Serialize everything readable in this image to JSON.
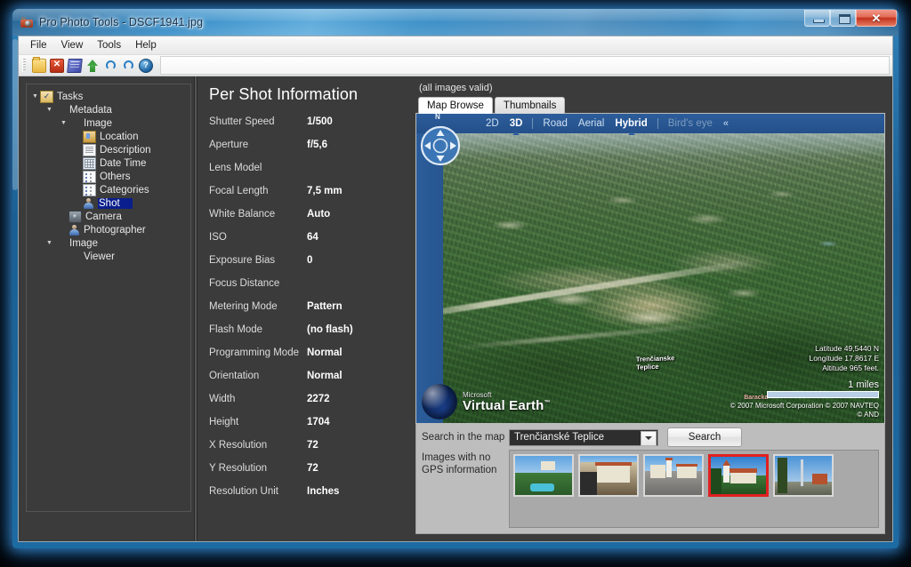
{
  "window": {
    "title": "Pro Photo Tools - DSCF1941.jpg",
    "app_icon": "camera-icon",
    "minimize_label": "–",
    "maximize_label": "□",
    "close_label": "✕"
  },
  "menubar": {
    "items": [
      {
        "label": "File"
      },
      {
        "label": "View"
      },
      {
        "label": "Tools"
      },
      {
        "label": "Help"
      }
    ]
  },
  "toolbar": {
    "buttons": [
      {
        "name": "open-folder-button",
        "icon": "folder-icon"
      },
      {
        "name": "remove-button",
        "icon": "red-x-icon"
      },
      {
        "name": "edit-metadata-button",
        "icon": "note-icon"
      },
      {
        "name": "upload-button",
        "icon": "green-up-arrow-icon"
      },
      {
        "name": "undo-button",
        "icon": "undo-arrow-icon"
      },
      {
        "name": "redo-button",
        "icon": "redo-arrow-icon"
      },
      {
        "name": "help-button",
        "icon": "help-icon"
      }
    ]
  },
  "tree": {
    "nodes": [
      {
        "label": "Tasks",
        "indent": 0,
        "expander": "▼",
        "icon": "tasks-checkbox-icon",
        "selected": false
      },
      {
        "label": "Metadata",
        "indent": 1,
        "expander": "▼",
        "icon": "none",
        "selected": false
      },
      {
        "label": "Image",
        "indent": 2,
        "expander": "▼",
        "icon": "none",
        "selected": false
      },
      {
        "label": "Location",
        "indent": 3,
        "expander": "",
        "icon": "location-icon",
        "selected": false
      },
      {
        "label": "Description",
        "indent": 3,
        "expander": "",
        "icon": "document-icon",
        "selected": false
      },
      {
        "label": "Date Time",
        "indent": 3,
        "expander": "",
        "icon": "calendar-grid-icon",
        "selected": false
      },
      {
        "label": "Others",
        "indent": 3,
        "expander": "",
        "icon": "list-icon",
        "selected": false
      },
      {
        "label": "Categories",
        "indent": 3,
        "expander": "",
        "icon": "list-icon",
        "selected": false
      },
      {
        "label": "Shot",
        "indent": 3,
        "expander": "",
        "icon": "person-icon",
        "selected": true
      },
      {
        "label": "Camera",
        "indent": 2,
        "expander": "",
        "icon": "camera-icon",
        "selected": false
      },
      {
        "label": "Photographer",
        "indent": 2,
        "expander": "",
        "icon": "person-icon",
        "selected": false
      },
      {
        "label": "Image",
        "indent": 1,
        "expander": "▼",
        "icon": "none",
        "selected": false
      },
      {
        "label": "Viewer",
        "indent": 2,
        "expander": "",
        "icon": "none",
        "selected": false
      }
    ]
  },
  "metadata": {
    "title": "Per Shot Information",
    "rows": [
      {
        "label": "Shutter Speed",
        "value": "1/500"
      },
      {
        "label": "Aperture",
        "value": "f/5,6"
      },
      {
        "label": "Lens Model",
        "value": ""
      },
      {
        "label": "Focal Length",
        "value": "7,5 mm"
      },
      {
        "label": "White Balance",
        "value": "Auto"
      },
      {
        "label": "ISO",
        "value": "64"
      },
      {
        "label": "Exposure Bias",
        "value": "0"
      },
      {
        "label": "Focus Distance",
        "value": ""
      },
      {
        "label": "Metering Mode",
        "value": "Pattern"
      },
      {
        "label": "Flash Mode",
        "value": "(no flash)"
      },
      {
        "label": "Programming Mode",
        "value": "Normal"
      },
      {
        "label": "Orientation",
        "value": "Normal"
      },
      {
        "label": "Width",
        "value": "2272"
      },
      {
        "label": "Height",
        "value": "1704"
      },
      {
        "label": "X Resolution",
        "value": "72"
      },
      {
        "label": "Y Resolution",
        "value": "72"
      },
      {
        "label": "Resolution Unit",
        "value": "Inches"
      }
    ]
  },
  "map_panel": {
    "status": "(all images valid)",
    "tabs": [
      {
        "label": "Map Browse",
        "active": true
      },
      {
        "label": "Thumbnails",
        "active": false
      }
    ],
    "nav": {
      "compass_north": "N",
      "modes": [
        {
          "label": "2D",
          "active": false,
          "dim": false
        },
        {
          "label": "3D",
          "active": true,
          "dim": false
        },
        {
          "label": "Road",
          "active": false,
          "dim": false
        },
        {
          "label": "Aerial",
          "active": false,
          "dim": false
        },
        {
          "label": "Hybrid",
          "active": true,
          "dim": false
        },
        {
          "label": "Bird's eye",
          "active": false,
          "dim": true
        }
      ],
      "collapse_label": "«"
    },
    "tools": [
      {
        "name": "zoom-in-icon"
      },
      {
        "name": "zoom-out-icon"
      },
      {
        "name": "rotate-right-icon"
      },
      {
        "name": "rotate-left-icon"
      },
      {
        "name": "tilt-up-icon"
      },
      {
        "name": "tilt-down-icon"
      }
    ],
    "overlay": {
      "latitude": "Latitude 49,5440 N",
      "longitude": "Longitude 17,8617 E",
      "altitude": "Altitude 965 feet.",
      "scale": "1 miles",
      "copyright_line1": "© 2007 Microsoft Corporation   © 2007 NAVTEQ",
      "copyright_line2": "© AND",
      "brand_top": "Microsoft",
      "brand_main": "Virtual Earth",
      "brand_tm": "™",
      "town_label_line1": "Trenčianske",
      "town_label_line2": "Teplice",
      "poi_label": "Baracka"
    }
  },
  "search": {
    "label": "Search in the map",
    "value": "Trenčianské Teplice",
    "placeholder": "Search in the map",
    "button_label": "Search",
    "dropdown_icon": "chevron-down-icon"
  },
  "gps": {
    "label_line1": "Images with no",
    "label_line2": "GPS information",
    "thumbnails": [
      {
        "name": "thumbnail-pool",
        "selected": false
      },
      {
        "name": "thumbnail-building",
        "selected": false
      },
      {
        "name": "thumbnail-square",
        "selected": false
      },
      {
        "name": "thumbnail-church",
        "selected": true
      },
      {
        "name": "thumbnail-street",
        "selected": false
      }
    ]
  },
  "colors": {
    "window_frame": "#1d6ba3",
    "panel_dark": "#3b3b3b",
    "selection_blue": "#0a1f8c",
    "map_nav_blue": "#2c5d9b",
    "selection_red": "#e02020",
    "panel_gray": "#bdbdbd"
  }
}
